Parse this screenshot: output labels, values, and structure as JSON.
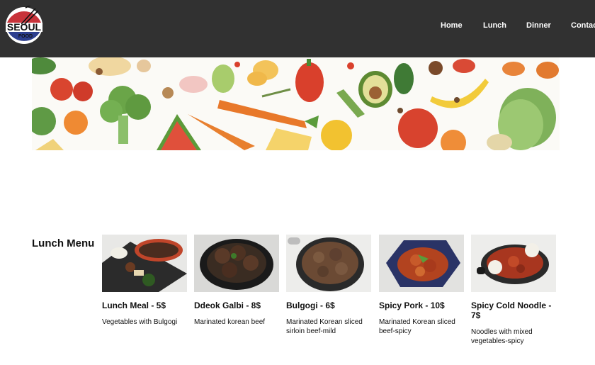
{
  "brand": {
    "logo_text_main": "SEOUL",
    "logo_text_sub": "FOOD"
  },
  "nav": {
    "items": [
      {
        "label": "Home"
      },
      {
        "label": "Lunch"
      },
      {
        "label": "Dinner"
      },
      {
        "label": "Contact"
      }
    ]
  },
  "banner": {
    "icon": "vegetables-illustration"
  },
  "menu": {
    "title": "Lunch Menu",
    "items": [
      {
        "name": "Lunch Meal - 5$",
        "description": "Vegetables with Bulgogi",
        "icon": "lunch-meal-photo"
      },
      {
        "name": "Ddeok Galbi - 8$",
        "description": "Marinated korean beef",
        "icon": "ddeok-galbi-photo"
      },
      {
        "name": "Bulgogi - 6$",
        "description": "Marinated Korean sliced sirloin beef-mild",
        "icon": "bulgogi-photo"
      },
      {
        "name": "Spicy Pork - 10$",
        "description": "Marinated Korean sliced beef-spicy",
        "icon": "spicy-pork-photo"
      },
      {
        "name": "Spicy Cold Noodle - 7$",
        "description": "Noodles with mixed vegetables-spicy",
        "icon": "spicy-cold-noodle-photo"
      }
    ]
  },
  "colors": {
    "header_bg": "#313131",
    "nav_text": "#ffffff",
    "logo_red": "#c8333a",
    "logo_blue": "#2d3f8f"
  }
}
